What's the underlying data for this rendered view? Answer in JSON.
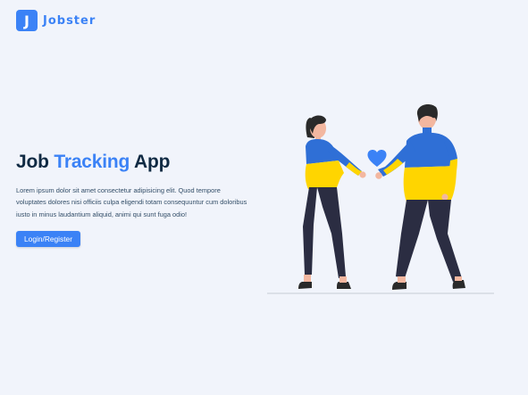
{
  "brand": {
    "logo_letter": "J",
    "name": "Jobster"
  },
  "hero": {
    "title_part1": "Job ",
    "title_accent": "Tracking",
    "title_part2": " App",
    "description": "Lorem ipsum dolor sit amet consectetur adipisicing elit. Quod tempore voluptates dolores nisi officiis culpa eligendi totam consequuntur cum doloribus iusto in minus laudantium aliquid, animi qui sunt fuga odio!",
    "cta_label": "Login/Register"
  },
  "colors": {
    "primary": "#3b82f6",
    "primary_text": "#3b82f6",
    "heading": "#102a43",
    "background": "#f1f4fb",
    "flag_blue": "#2f6fd6",
    "flag_yellow": "#ffd500"
  },
  "illustration": {
    "icon": "couple-holding-hands-heart-icon"
  }
}
